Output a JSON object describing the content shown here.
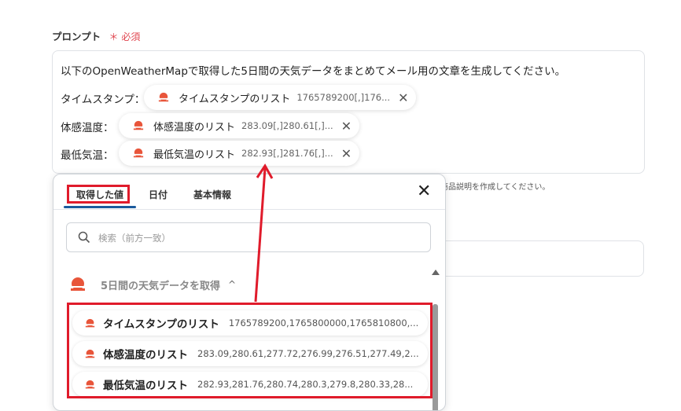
{
  "field": {
    "label": "プロンプト",
    "required_mark": "＊",
    "required_text": "必須"
  },
  "prompt": {
    "text": "以下のOpenWeatherMapで取得した5日間の天気データをまとめてメール用の文章を生成してください。",
    "rows": [
      {
        "label": "タイムスタンプ：",
        "chip_name": "タイムスタンプのリスト",
        "chip_value": "1765789200[,]176...",
        "remove": "✕"
      },
      {
        "label": "体感温度：",
        "chip_name": "体感温度のリスト",
        "chip_value": "283.09[,]280.61[,]...",
        "remove": "✕"
      },
      {
        "label": "最低気温：",
        "chip_name": "最低気温のリスト",
        "chip_value": "282.93[,]281.76[,]...",
        "remove": "✕"
      }
    ]
  },
  "background_hint": "商品説明を作成してください。",
  "panel": {
    "tabs": [
      {
        "label": "取得した値",
        "active": true
      },
      {
        "label": "日付",
        "active": false
      },
      {
        "label": "基本情報",
        "active": false
      }
    ],
    "close_glyph": "✕",
    "search_placeholder": "検索（前方一致）",
    "group": {
      "title": "5日間の天気データを取得",
      "caret": "^",
      "items": [
        {
          "name": "タイムスタンプのリスト",
          "value": "1765789200,1765800000,1765810800,..."
        },
        {
          "name": "体感温度のリスト",
          "value": "283.09,280.61,277.72,276.99,276.51,277.49,2..."
        },
        {
          "name": "最低気温のリスト",
          "value": "282.93,281.76,280.74,280.3,279.8,280.33,28..."
        }
      ]
    }
  },
  "colors": {
    "accent_red": "#e01b2b",
    "required_red": "#e0454f",
    "tab_underline": "#1a5a9c",
    "icon_orange": "#e8553a"
  },
  "icons": {
    "weather": "cloud-sun-icon",
    "close": "close-icon",
    "search": "search-icon",
    "remove": "remove-icon",
    "collapse": "chevron-up-icon"
  }
}
